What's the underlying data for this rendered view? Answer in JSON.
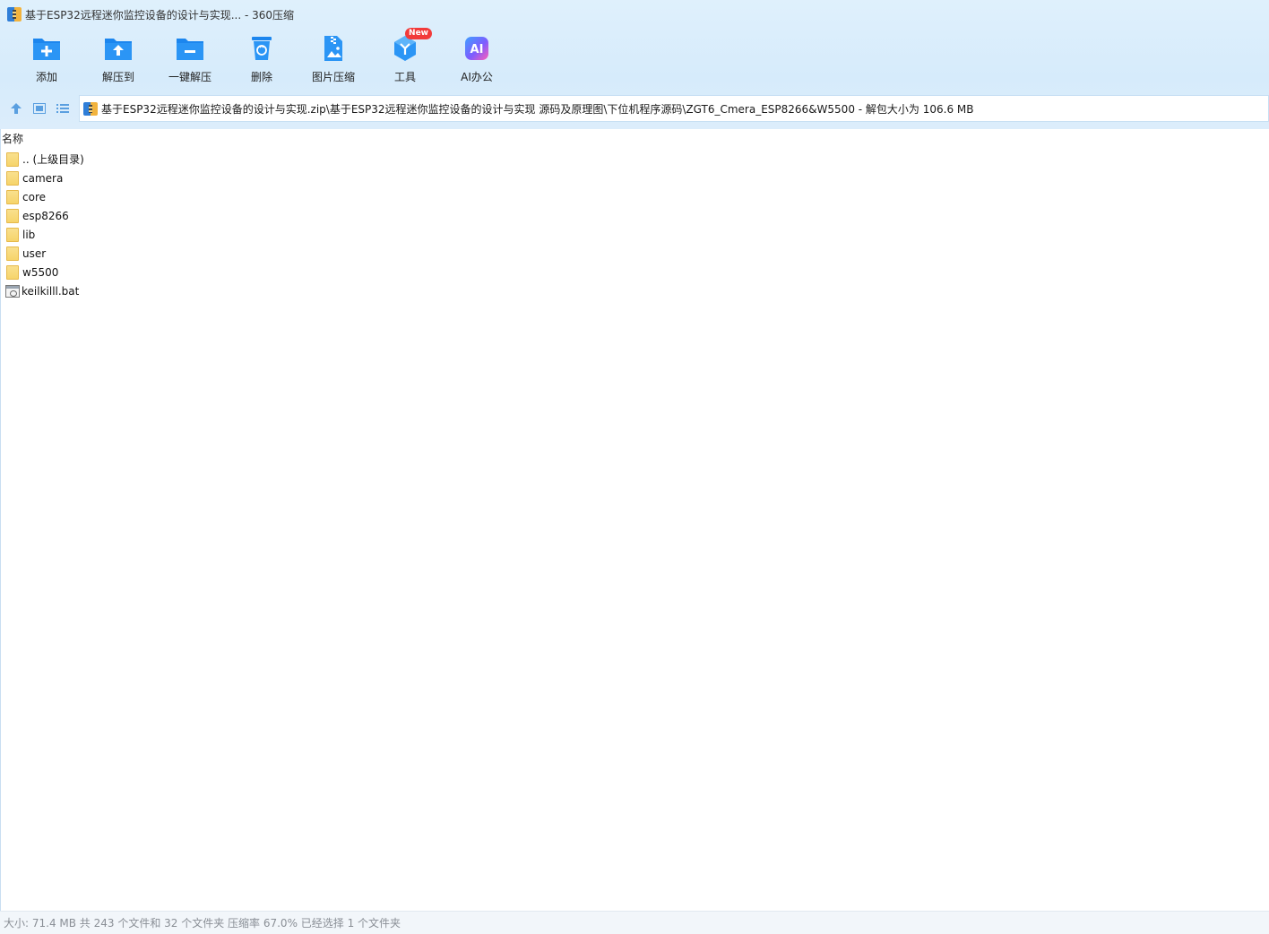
{
  "window": {
    "title": "基于ESP32远程迷你监控设备的设计与实现... - 360压缩"
  },
  "toolbar": {
    "items": [
      {
        "label": "添加",
        "icon": "add-folder-icon"
      },
      {
        "label": "解压到",
        "icon": "extract-to-icon"
      },
      {
        "label": "一键解压",
        "icon": "one-click-extract-icon"
      },
      {
        "label": "删除",
        "icon": "delete-bin-icon"
      },
      {
        "label": "图片压缩",
        "icon": "image-compress-icon"
      },
      {
        "label": "工具",
        "icon": "tools-icon",
        "badge": "New"
      },
      {
        "label": "AI办公",
        "icon": "ai-office-icon",
        "icon_text": "AI"
      }
    ]
  },
  "nav": {
    "path": "基于ESP32远程迷你监控设备的设计与实现.zip\\基于ESP32远程迷你监控设备的设计与实现 源码及原理图\\下位机程序源码\\ZGT6_Cmera_ESP8266&W5500 - 解包大小为 106.6 MB"
  },
  "list": {
    "column_name": "名称",
    "items": [
      {
        "name": ".. (上级目录)",
        "type": "folder"
      },
      {
        "name": "camera",
        "type": "folder"
      },
      {
        "name": "core",
        "type": "folder"
      },
      {
        "name": "esp8266",
        "type": "folder"
      },
      {
        "name": "lib",
        "type": "folder"
      },
      {
        "name": "user",
        "type": "folder"
      },
      {
        "name": "w5500",
        "type": "folder"
      },
      {
        "name": "keilkilll.bat",
        "type": "file"
      }
    ]
  },
  "status": {
    "text": "大小: 71.4 MB 共 243 个文件和 32 个文件夹 压缩率 67.0% 已经选择 1 个文件夹"
  },
  "colors": {
    "accent_blue": "#1e8ef0",
    "header_bg": "#d9edfb",
    "badge_red": "#f23b3b"
  }
}
